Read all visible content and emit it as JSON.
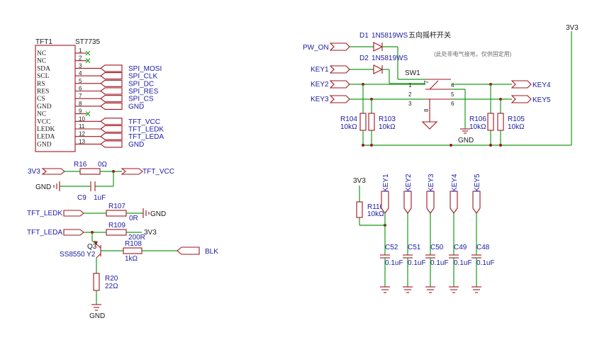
{
  "tft": {
    "ref": "TFT1",
    "part": "ST7735",
    "pins": [
      {
        "name": "NC",
        "num": "1"
      },
      {
        "name": "NC",
        "num": "2"
      },
      {
        "name": "SDA",
        "num": "3"
      },
      {
        "name": "SCL",
        "num": "4"
      },
      {
        "name": "RS",
        "num": "5"
      },
      {
        "name": "RES",
        "num": "6"
      },
      {
        "name": "CS",
        "num": "7"
      },
      {
        "name": "GND",
        "num": "8"
      },
      {
        "name": "NC",
        "num": "9"
      },
      {
        "name": "VCC",
        "num": "10"
      },
      {
        "name": "LEDK",
        "num": "11"
      },
      {
        "name": "LEDA",
        "num": "12"
      },
      {
        "name": "GND",
        "num": "13"
      }
    ],
    "nets": [
      "SPI_MOSI",
      "SPI_CLK",
      "SPI_DC",
      "SPI_RES",
      "SPI_CS",
      "GND",
      "TFT_VCC",
      "TFT_LEDK",
      "TFT_LEDA",
      "GND"
    ]
  },
  "power_circuit": {
    "supply": "3V3",
    "r16": {
      "ref": "R16",
      "value": "0Ω"
    },
    "out_net": "TFT_VCC",
    "gnd": "GND",
    "c9": {
      "ref": "C9",
      "value": "1uF"
    }
  },
  "ledk_circuit": {
    "net": "TFT_LEDK",
    "ref": "R107",
    "value": "0R",
    "gnd": "GND"
  },
  "leda_circuit": {
    "net": "TFT_LEDA",
    "r109": {
      "ref": "R109",
      "value": "200R"
    },
    "supply": "3V3",
    "q3": {
      "ref": "Q3",
      "part": "SS8550 Y2"
    },
    "r108": {
      "ref": "R108",
      "value": "1kΩ"
    },
    "blk": "BLK",
    "r20": {
      "ref": "R20",
      "value": "22Ω"
    },
    "gnd": "GND"
  },
  "switch_circuit": {
    "pw_on": "PW_ON",
    "d1": {
      "ref": "D1",
      "part": "1N5819WS"
    },
    "d2": {
      "ref": "D2",
      "part": "1N5819WS"
    },
    "title": "五向摇杆开关",
    "note": "(此处非电气接地，仅供固定用)",
    "sw": "SW1",
    "sw_pins": [
      "1",
      "2",
      "3",
      "4",
      "5",
      "6",
      "7",
      "8"
    ],
    "keys_left": [
      "KEY1",
      "KEY2",
      "KEY3"
    ],
    "keys_right": [
      "KEY4",
      "KEY5"
    ],
    "supply": "3V3",
    "gnd": "GND",
    "resistors": [
      {
        "ref": "R104",
        "value": "10kΩ"
      },
      {
        "ref": "R103",
        "value": "10kΩ"
      },
      {
        "ref": "R106",
        "value": "10kΩ"
      },
      {
        "ref": "R105",
        "value": "10kΩ"
      }
    ]
  },
  "filter_circuit": {
    "supply": "3V3",
    "r110": {
      "ref": "R110",
      "value": "10kΩ"
    },
    "keys": [
      "KEY1",
      "KEY2",
      "KEY3",
      "KEY4",
      "KEY5"
    ],
    "caps": [
      {
        "ref": "C52",
        "value": "0.1uF"
      },
      {
        "ref": "C51",
        "value": "0.1uF"
      },
      {
        "ref": "C50",
        "value": "0.1uF"
      },
      {
        "ref": "C49",
        "value": "0.1uF"
      },
      {
        "ref": "C48",
        "value": "0.1uF"
      }
    ]
  },
  "colors": {
    "wire": "#1a9a1a",
    "part": "#a0141e",
    "text": "#1a1aa5"
  }
}
